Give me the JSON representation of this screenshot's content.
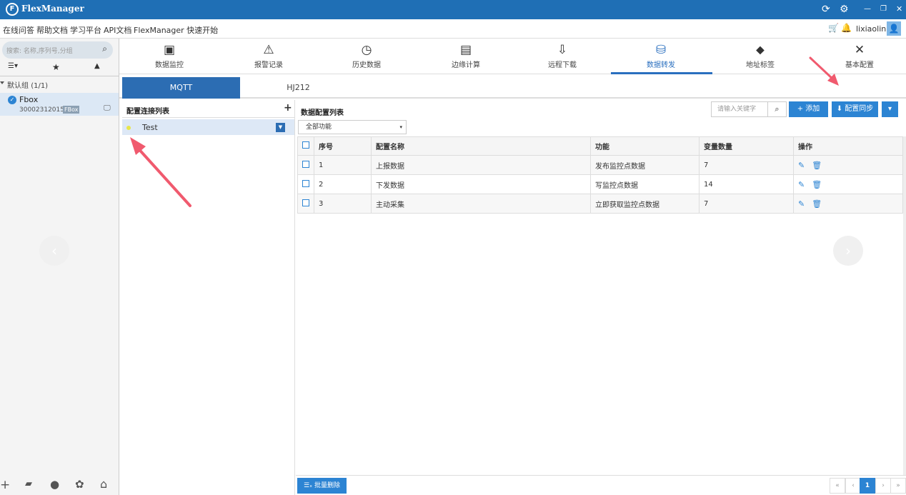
{
  "app": {
    "title": "FlexManager",
    "logo_letter": "F"
  },
  "titlebar_icons": {
    "refresh": "⟳",
    "settings": "⚙",
    "minimize": "—",
    "restore": "❐",
    "close": "✕"
  },
  "menubar": {
    "links": [
      "在线问答",
      "帮助文档",
      "学习平台",
      "API文档",
      "FlexManager 快速开始"
    ],
    "cart_icon": "🛒",
    "bell_icon": "🔔",
    "username": "lixiaolin",
    "avatar_icon": "👤"
  },
  "sidebar": {
    "search_placeholder": "搜索: 名称,序列号,分组",
    "search_icon": "⌕",
    "tabs": {
      "list": "☰▾",
      "star": "★",
      "warning": "▲"
    },
    "group_label": "默认组",
    "group_count": "(1/1)",
    "device": {
      "name": "Fbox",
      "serial": "300023120158",
      "badge": "FBox",
      "check": "✓",
      "monitor_icon": "🖵"
    },
    "bottom_icons": {
      "add": "+",
      "folder": "▰",
      "user": "●",
      "gear": "✿",
      "home": "⌂"
    },
    "prev": "‹",
    "next": "›"
  },
  "nav": {
    "items": [
      {
        "label": "数据监控",
        "icon": "▣"
      },
      {
        "label": "报警记录",
        "icon": "⚠"
      },
      {
        "label": "历史数据",
        "icon": "◷"
      },
      {
        "label": "边缘计算",
        "icon": "▤"
      },
      {
        "label": "远程下载",
        "icon": "⇩"
      },
      {
        "label": "数据转发",
        "icon": "⛁"
      },
      {
        "label": "地址标签",
        "icon": "⬥"
      },
      {
        "label": "基本配置",
        "icon": "✕"
      }
    ],
    "active_index": 5
  },
  "subtabs": {
    "mqtt": "MQTT",
    "hj212": "HJ212"
  },
  "left_panel": {
    "title": "配置连接列表",
    "add": "+",
    "connection": {
      "name": "Test",
      "dropdown": "▼"
    }
  },
  "right_panel": {
    "title": "数据配置列表",
    "keyword_placeholder": "请输入关键字",
    "search_icon": "⌕",
    "add_label": "+ 添加",
    "sync_label": "⬇ 配置同步",
    "more": "▾",
    "filter_value": "全部功能",
    "filter_caret": "▾"
  },
  "table": {
    "headers": [
      "序号",
      "配置名称",
      "功能",
      "变量数量",
      "操作"
    ],
    "rows": [
      {
        "id": "1",
        "name": "上报数据",
        "func": "发布监控点数据",
        "count": "7"
      },
      {
        "id": "2",
        "name": "下发数据",
        "func": "写监控点数据",
        "count": "14"
      },
      {
        "id": "3",
        "name": "主动采集",
        "func": "立即获取监控点数据",
        "count": "7"
      }
    ],
    "edit_icon": "✎",
    "delete_icon": "🗑"
  },
  "footer": {
    "bulk_delete": "☰ₓ 批量删除",
    "pager": {
      "first": "«",
      "prev": "‹",
      "current": "1",
      "next": "›",
      "last": "»"
    }
  },
  "colors": {
    "accent": "#2c84d3",
    "titlebar": "#1f6fb5",
    "arrow": "#f05a6e",
    "active_row": "#dde8f6"
  }
}
